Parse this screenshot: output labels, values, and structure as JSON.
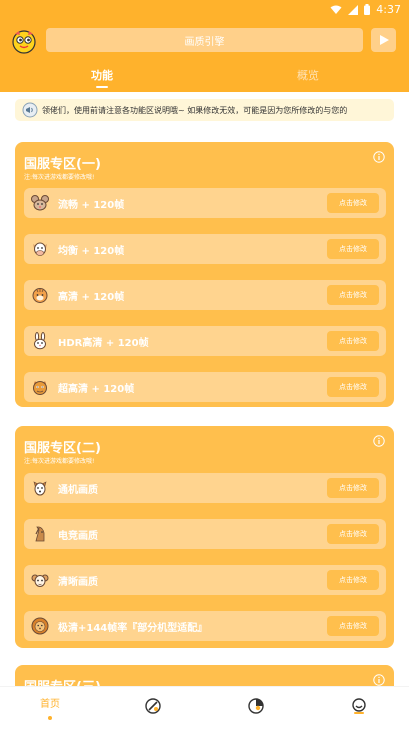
{
  "status": {
    "time": "4:37"
  },
  "header": {
    "title": "画质引擎"
  },
  "tabs": {
    "function": "功能",
    "overview": "概览"
  },
  "notice": {
    "text": "领佬们，使用前请注意各功能区说明哦~        如果修改无效，可能是因为您所修改的与您的"
  },
  "card1": {
    "title": "国服专区(一)",
    "note": "注:每次进游戏都要修改哦!",
    "items": [
      {
        "label": "流畅 + 120帧",
        "button": "点击修改",
        "icon": "mouse-icon"
      },
      {
        "label": "均衡 + 120帧",
        "button": "点击修改",
        "icon": "cow-icon"
      },
      {
        "label": "高清 + 120帧",
        "button": "点击修改",
        "icon": "tiger-icon"
      },
      {
        "label": "HDR高清 + 120帧",
        "button": "点击修改",
        "icon": "rabbit-icon"
      },
      {
        "label": "超高清 + 120帧",
        "button": "点击修改",
        "icon": "dragon-icon"
      }
    ]
  },
  "card2": {
    "title": "国服专区(二)",
    "note": "注:每次进游戏都要修改哦!",
    "items": [
      {
        "label": "通机画质",
        "button": "点击修改",
        "icon": "dog-icon"
      },
      {
        "label": "电竞画质",
        "button": "点击修改",
        "icon": "horse-icon"
      },
      {
        "label": "清晰画质",
        "button": "点击修改",
        "icon": "sheep-icon"
      },
      {
        "label": "极清+144帧率『部分机型适配』",
        "button": "点击修改",
        "icon": "lion-icon"
      }
    ]
  },
  "card3": {
    "title": "国服专区(三)"
  },
  "nav": {
    "home": "首页"
  },
  "colors": {
    "brand": "#ffb22c",
    "card": "#ffbf4d",
    "row": "#ffd48f"
  }
}
